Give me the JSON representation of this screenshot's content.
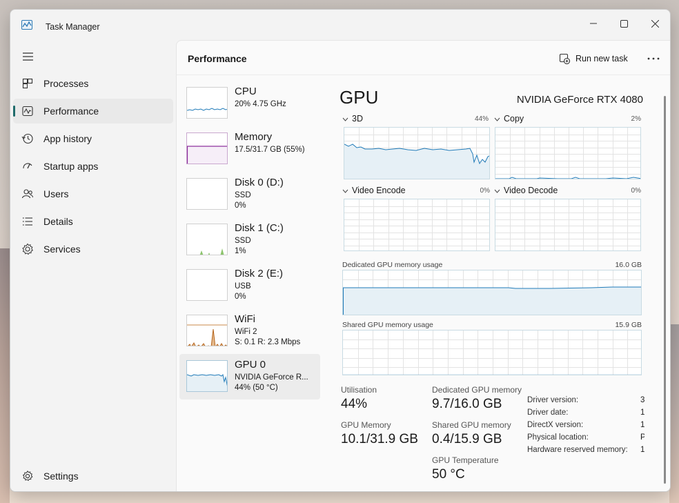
{
  "window": {
    "title": "Task Manager"
  },
  "nav": {
    "items": [
      {
        "label": "Processes",
        "icon": "processes-icon"
      },
      {
        "label": "Performance",
        "icon": "performance-icon"
      },
      {
        "label": "App history",
        "icon": "history-icon"
      },
      {
        "label": "Startup apps",
        "icon": "startup-icon"
      },
      {
        "label": "Users",
        "icon": "users-icon"
      },
      {
        "label": "Details",
        "icon": "details-icon"
      },
      {
        "label": "Services",
        "icon": "services-icon"
      }
    ],
    "settings_label": "Settings"
  },
  "header": {
    "title": "Performance",
    "run_new_task_label": "Run new task"
  },
  "devices": [
    {
      "name": "CPU",
      "lines": [
        "20%  4.75 GHz"
      ],
      "color": "#1f7ab8"
    },
    {
      "name": "Memory",
      "lines": [
        "17.5/31.7 GB (55%)"
      ],
      "color": "#8b2a9b"
    },
    {
      "name": "Disk 0 (D:)",
      "lines": [
        "SSD",
        "0%"
      ],
      "color": "#4c9a2a"
    },
    {
      "name": "Disk 1 (C:)",
      "lines": [
        "SSD",
        "1%"
      ],
      "color": "#4c9a2a"
    },
    {
      "name": "Disk 2 (E:)",
      "lines": [
        "USB",
        "0%"
      ],
      "color": "#4c9a2a"
    },
    {
      "name": "WiFi",
      "lines": [
        "WiFi 2",
        "S: 0.1  R: 2.3 Mbps"
      ],
      "color": "#b5651d"
    },
    {
      "name": "GPU 0",
      "lines": [
        "NVIDIA GeForce R...",
        "44%  (50 °C)"
      ],
      "color": "#1f7ab8"
    }
  ],
  "gpu": {
    "title": "GPU",
    "model": "NVIDIA GeForce RTX 4080",
    "engines": [
      {
        "label": "3D",
        "percent": "44%"
      },
      {
        "label": "Copy",
        "percent": "2%"
      },
      {
        "label": "Video Encode",
        "percent": "0%"
      },
      {
        "label": "Video Decode",
        "percent": "0%"
      }
    ],
    "dedicated_mem_label": "Dedicated GPU memory usage",
    "dedicated_mem_max": "16.0 GB",
    "shared_mem_label": "Shared GPU memory usage",
    "shared_mem_max": "15.9 GB",
    "stats": {
      "utilisation_label": "Utilisation",
      "utilisation_value": "44%",
      "dedicated_label": "Dedicated GPU memory",
      "dedicated_value": "9.7/16.0 GB",
      "gpu_memory_label": "GPU Memory",
      "gpu_memory_value": "10.1/31.9 GB",
      "shared_label": "Shared GPU memory",
      "shared_value": "0.4/15.9 GB",
      "temp_label": "GPU Temperature",
      "temp_value": "50 °C"
    },
    "info": [
      {
        "label": "Driver version:",
        "value": "3"
      },
      {
        "label": "Driver date:",
        "value": "1"
      },
      {
        "label": "DirectX version:",
        "value": "1"
      },
      {
        "label": "Physical location:",
        "value": "P"
      },
      {
        "label": "Hardware reserved memory:",
        "value": "1"
      }
    ]
  },
  "colors": {
    "gpu_line": "#1f7ab8",
    "gpu_fill": "#e6f0f6",
    "grid": "#e3e3e3",
    "accent": "#1f6b6b"
  }
}
